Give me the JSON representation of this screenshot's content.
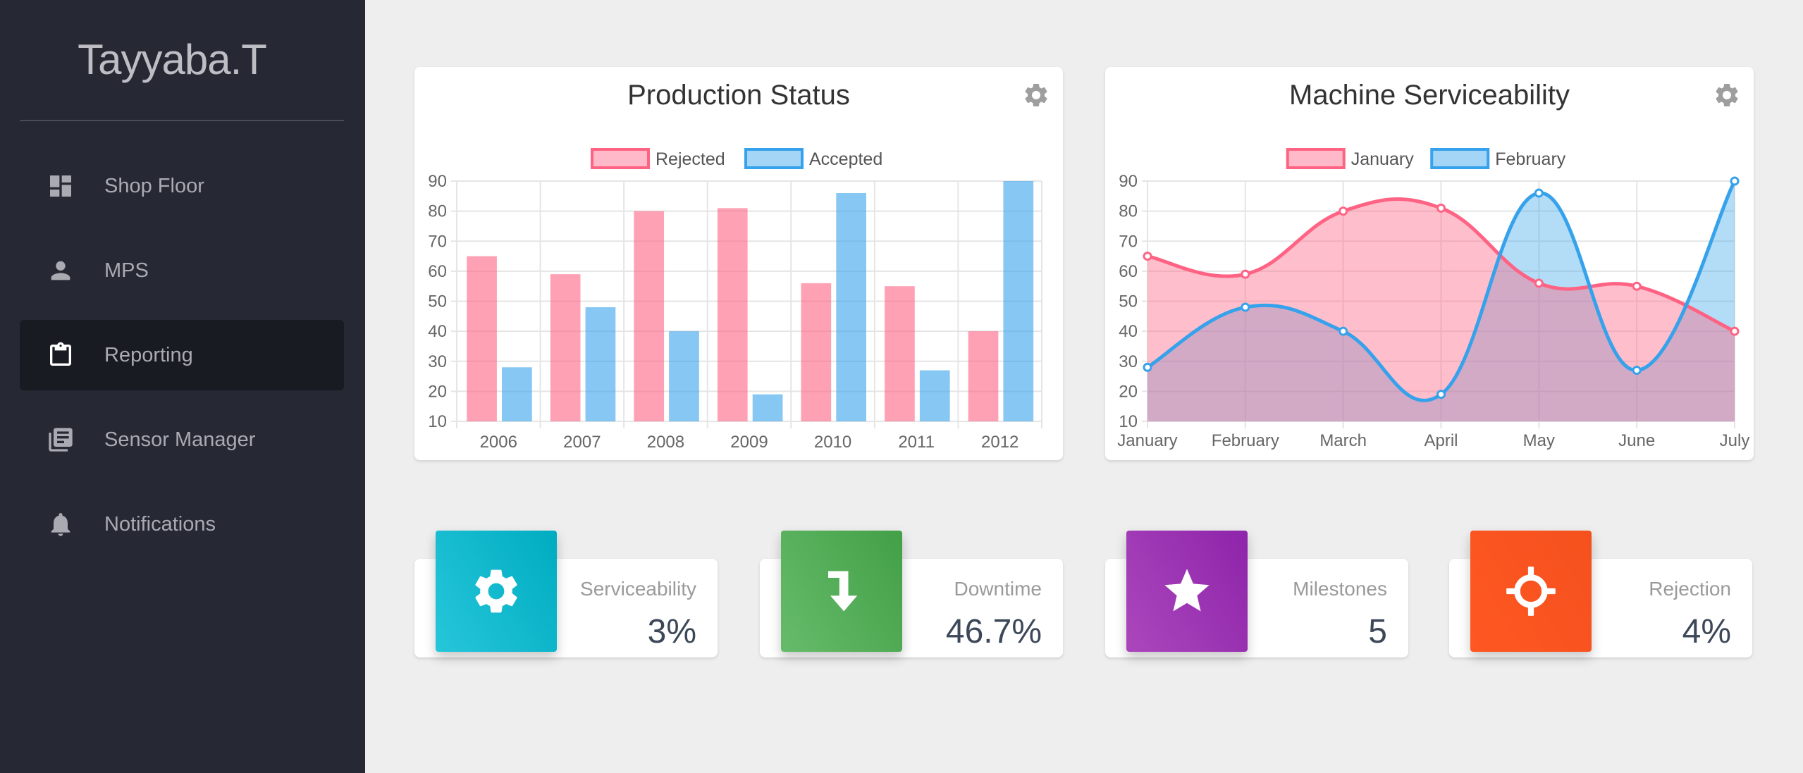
{
  "brand": {
    "name": "Tayyaba.T"
  },
  "sidebar": {
    "items": [
      {
        "label": "Shop Floor",
        "icon": "dashboard-icon",
        "active": false
      },
      {
        "label": "MPS",
        "icon": "person-icon",
        "active": false
      },
      {
        "label": "Reporting",
        "icon": "clipboard-icon",
        "active": true
      },
      {
        "label": "Sensor Manager",
        "icon": "library-books-icon",
        "active": false
      },
      {
        "label": "Notifications",
        "icon": "bell-icon",
        "active": false
      }
    ]
  },
  "colors": {
    "sidebar_bg": "#262834",
    "active_item_bg": "#191b22",
    "pink": "#ff6384",
    "blue": "#36a2eb",
    "cyan": "#26c6da",
    "green": "#43a047",
    "purple": "#ab47bc",
    "orange": "#ff5722"
  },
  "chart_data": [
    {
      "type": "bar",
      "title": "Production Status",
      "categories": [
        "2006",
        "2007",
        "2008",
        "2009",
        "2010",
        "2011",
        "2012"
      ],
      "series": [
        {
          "name": "Rejected",
          "values": [
            65,
            59,
            80,
            81,
            56,
            55,
            40
          ],
          "color": "#ff6384"
        },
        {
          "name": "Accepted",
          "values": [
            28,
            48,
            40,
            19,
            86,
            27,
            90
          ],
          "color": "#36a2eb"
        }
      ],
      "y_ticks": [
        10,
        20,
        30,
        40,
        50,
        60,
        70,
        80,
        90
      ],
      "ylim": [
        10,
        90
      ],
      "legend": "top",
      "grid": true
    },
    {
      "type": "area",
      "title": "Machine Serviceability",
      "categories": [
        "January",
        "February",
        "March",
        "April",
        "May",
        "June",
        "July"
      ],
      "series": [
        {
          "name": "January",
          "values": [
            65,
            59,
            80,
            81,
            56,
            55,
            40
          ],
          "color": "#ff6384"
        },
        {
          "name": "February",
          "values": [
            28,
            48,
            40,
            19,
            86,
            27,
            90
          ],
          "color": "#36a2eb"
        }
      ],
      "y_ticks": [
        10,
        20,
        30,
        40,
        50,
        60,
        70,
        80,
        90
      ],
      "ylim": [
        10,
        90
      ],
      "legend": "top",
      "grid": true
    }
  ],
  "stats": [
    {
      "label": "Serviceability",
      "value": "3%",
      "icon": "gear-icon",
      "color": "#26c6da"
    },
    {
      "label": "Downtime",
      "value": "46.7%",
      "icon": "turn-down-arrow-icon",
      "color": "#43a047"
    },
    {
      "label": "Milestones",
      "value": "5",
      "icon": "star-icon",
      "color": "#ab47bc"
    },
    {
      "label": "Rejection",
      "value": "4%",
      "icon": "crosshair-icon",
      "color": "#ff5722"
    }
  ]
}
